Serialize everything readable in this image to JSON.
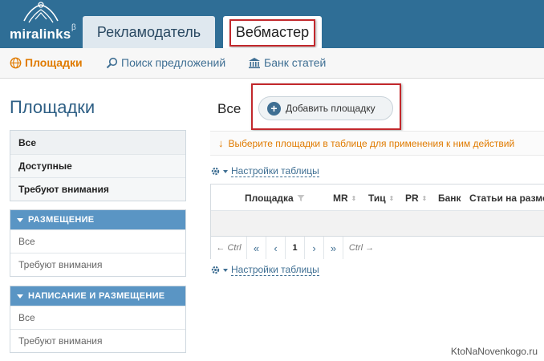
{
  "header": {
    "brand": "miralinks",
    "beta": "β",
    "tabs": [
      {
        "label": "Рекламодатель"
      },
      {
        "label": "Вебмастер"
      }
    ]
  },
  "subnav": {
    "items": [
      {
        "label": "Площадки",
        "icon": "globe-icon",
        "active": true
      },
      {
        "label": "Поиск предложений",
        "icon": "magnifier-icon"
      },
      {
        "label": "Банк статей",
        "icon": "bank-icon"
      }
    ]
  },
  "sidebar": {
    "title": "Площадки",
    "main": [
      "Все",
      "Доступные",
      "Требуют внимания"
    ],
    "placement": {
      "title": "РАЗМЕЩЕНИЕ",
      "items": [
        "Все",
        "Требуют внимания"
      ]
    },
    "writing": {
      "title": "НАПИСАНИЕ И РАЗМЕЩЕНИЕ",
      "items": [
        "Все",
        "Требуют внимания"
      ]
    }
  },
  "content": {
    "title": "Все",
    "add_button": "Добавить площадку",
    "notice": "Выберите площадки в таблице для применения к ним действий",
    "settings_label": "Настройки таблицы",
    "columns": [
      "Площадка",
      "MR",
      "Тиц",
      "PR",
      "Банк",
      "Статьи на разме"
    ],
    "pager": {
      "prev_ctrl": "← Ctrl",
      "first": "«",
      "prev": "‹",
      "page": "1",
      "next": "›",
      "last": "»",
      "next_ctrl": "Ctrl →"
    }
  },
  "watermark": "KtoNaNovenkogo.ru",
  "colors": {
    "header_bg": "#2f6e96",
    "accent_orange": "#e07b00",
    "link_blue": "#3f6f93",
    "section_head": "#5a95c4",
    "highlight_red": "#c2282c"
  }
}
